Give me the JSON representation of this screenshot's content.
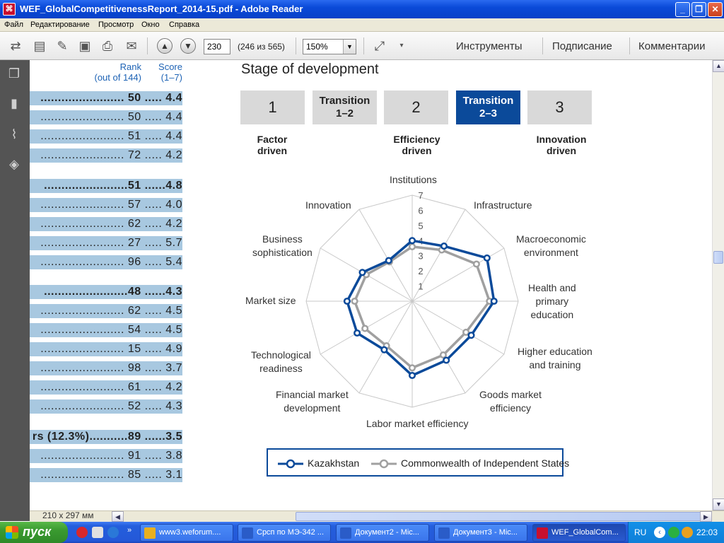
{
  "window": {
    "title": "WEF_GlobalCompetitivenessReport_2014-15.pdf - Adobe Reader"
  },
  "menu": [
    "Файл",
    "Редактирование",
    "Просмотр",
    "Окно",
    "Справка"
  ],
  "toolbar": {
    "page_number": "230",
    "page_count": "(246 из 565)",
    "zoom": "150%",
    "tools_label": "Инструменты",
    "sign_label": "Подписание",
    "comments_label": "Комментарии"
  },
  "rank_table": {
    "rank_header": "Rank\n(out of 144)",
    "score_header": "Score\n(1–7)",
    "rows": [
      {
        "text": "........................ 50 ..... 4.4",
        "bold": true
      },
      {
        "text": "........................ 50 ..... 4.4",
        "bold": false
      },
      {
        "text": "........................ 51 ..... 4.4",
        "bold": false
      },
      {
        "text": "........................ 72 ..... 4.2",
        "bold": false
      },
      {
        "text": "........................51 ......4.8",
        "bold": true
      },
      {
        "text": "........................ 57 ..... 4.0",
        "bold": false
      },
      {
        "text": "........................ 62 ..... 4.2",
        "bold": false
      },
      {
        "text": "........................ 27 ..... 5.7",
        "bold": false
      },
      {
        "text": "........................ 96 ..... 5.4",
        "bold": false
      },
      {
        "text": "........................48 ......4.3",
        "bold": true
      },
      {
        "text": "........................ 62 ..... 4.5",
        "bold": false
      },
      {
        "text": "........................ 54 ..... 4.5",
        "bold": false
      },
      {
        "text": "........................ 15 ..... 4.9",
        "bold": false
      },
      {
        "text": "........................ 98 ..... 3.7",
        "bold": false
      },
      {
        "text": "........................ 61 ..... 4.2",
        "bold": false
      },
      {
        "text": "........................ 52 ..... 4.3",
        "bold": false
      },
      {
        "text": "rs (12.3%)...........89 ......3.5",
        "bold": true
      },
      {
        "text": "........................ 91 ..... 3.8",
        "bold": false
      },
      {
        "text": "........................ 85 ..... 3.1",
        "bold": false
      }
    ]
  },
  "stage": {
    "title": "Stage of development",
    "boxes": [
      {
        "label": "1",
        "kind": "num",
        "active": false
      },
      {
        "label": "Transition\n1–2",
        "kind": "tr",
        "active": false
      },
      {
        "label": "2",
        "kind": "num",
        "active": false
      },
      {
        "label": "Transition\n2–3",
        "kind": "tr",
        "active": true
      },
      {
        "label": "3",
        "kind": "num",
        "active": false
      }
    ],
    "labels": [
      "Factor\ndriven",
      "Efficiency\ndriven",
      "Innovation\ndriven"
    ]
  },
  "chart_data": {
    "type": "radar",
    "axes": [
      "Institutions",
      "Infrastructure",
      "Macroeconomic\nenvironment",
      "Health and\nprimary\neducation",
      "Higher education\nand training",
      "Goods market\nefficiency",
      "Labor market efficiency",
      "Financial market\ndevelopment",
      "Technological\nreadiness",
      "Market size",
      "Business\nsophistication",
      "Innovation"
    ],
    "range": [
      1,
      7
    ],
    "ticks": [
      "1",
      "2",
      "3",
      "4",
      "5",
      "6",
      "7"
    ],
    "series": [
      {
        "name": "Kazakhstan",
        "color": "#0b4a9a",
        "values": [
          4.0,
          4.2,
          5.7,
          5.4,
          4.5,
          4.5,
          4.9,
          3.7,
          4.2,
          4.3,
          3.8,
          3.1
        ]
      },
      {
        "name": "Commonwealth of Independent States",
        "color": "#a0a0a0",
        "values": [
          3.6,
          3.9,
          4.9,
          5.1,
          4.1,
          4.1,
          4.4,
          3.4,
          3.6,
          3.8,
          3.5,
          3.0
        ]
      }
    ]
  },
  "status": {
    "page_size": "210 x 297 мм"
  },
  "taskbar": {
    "start_label": "пуск",
    "tasks": [
      {
        "label": "www3.weforum....",
        "color": "#e8b020",
        "active": false
      },
      {
        "label": "Срсп по МЭ-342 ...",
        "color": "#2a5cc8",
        "active": false
      },
      {
        "label": "Документ2 - Mic...",
        "color": "#2a5cc8",
        "active": false
      },
      {
        "label": "Документ3 - Mic...",
        "color": "#2a5cc8",
        "active": false
      },
      {
        "label": "WEF_GlobalCom...",
        "color": "#c8102e",
        "active": true
      }
    ],
    "lang": "RU",
    "time": "22:03"
  }
}
